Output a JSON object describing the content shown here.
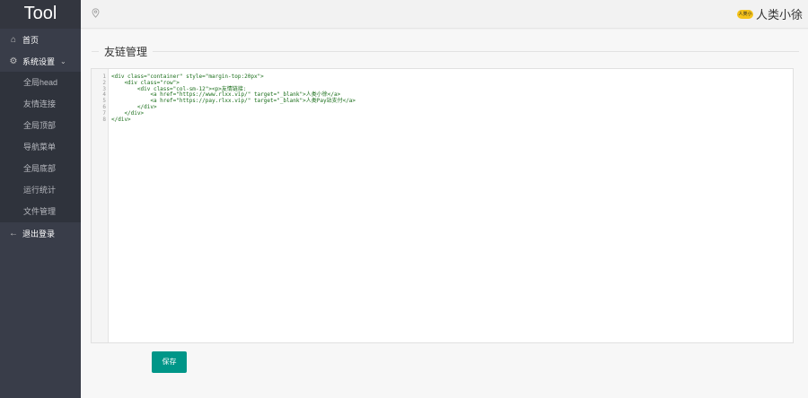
{
  "app": {
    "logo": "Tool"
  },
  "sidebar": {
    "items": [
      {
        "label": "首页",
        "icon": "home-icon"
      },
      {
        "label": "系统设置",
        "icon": "gear-icon",
        "expanded": true
      }
    ],
    "subitems": [
      "全局head",
      "友情连接",
      "全局顶部",
      "导航菜单",
      "全局底部",
      "运行统计",
      "文件管理"
    ],
    "logout": "退出登录"
  },
  "header": {
    "user_name": "人类小徐",
    "avatar_text": "人类小徐"
  },
  "main": {
    "title": "友链管理",
    "editor": {
      "line_numbers": [
        "1",
        "2",
        "3",
        "4",
        "5",
        "6",
        "7",
        "8"
      ],
      "lines": [
        "<div class=\"container\" style=\"margin-top:20px\">",
        "    <div class=\"row\">",
        "        <div class=\"col-sm-12\"><p>友情链接:",
        "            <a href=\"https://www.rlxx.vip/\" target=\"_blank\">人类小徐</a>",
        "            <a href=\"https://pay.rlxx.vip/\" target=\"_blank\">人类Pay站支付</a>",
        "        </div>",
        "    </div>",
        "</div>"
      ]
    },
    "save_label": "保存"
  },
  "colors": {
    "sidebar_bg": "#393d49",
    "accent": "#009688",
    "code_green": "#1a6e1a"
  }
}
